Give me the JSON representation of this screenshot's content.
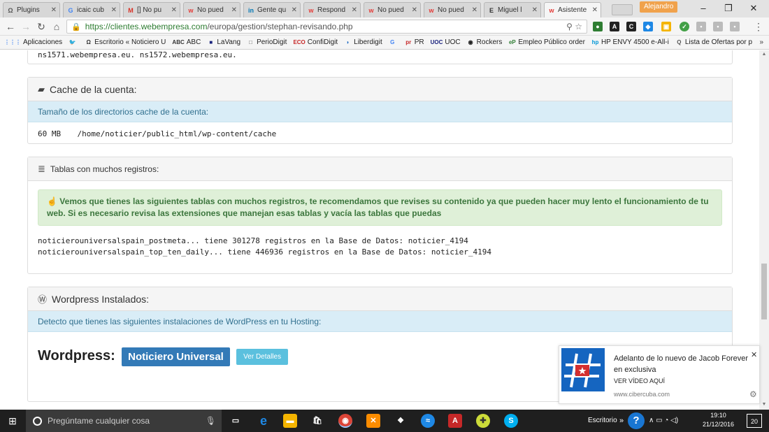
{
  "browser": {
    "tabs": [
      {
        "label": "Plugins",
        "favicon": "Ω",
        "color": "#555"
      },
      {
        "label": "icaic cub",
        "favicon": "G",
        "color": "#4285f4"
      },
      {
        "label": "[] No pu",
        "favicon": "M",
        "color": "#d93025"
      },
      {
        "label": "No pued",
        "favicon": "w",
        "color": "#e53935"
      },
      {
        "label": "Gente qu",
        "favicon": "in",
        "color": "#0077b5"
      },
      {
        "label": "Respond",
        "favicon": "w",
        "color": "#e53935"
      },
      {
        "label": "No pued",
        "favicon": "w",
        "color": "#e53935"
      },
      {
        "label": "No pued",
        "favicon": "w",
        "color": "#e53935"
      },
      {
        "label": "Miguel l",
        "favicon": "E",
        "color": "#333"
      },
      {
        "label": "Asistente",
        "favicon": "w",
        "color": "#e53935",
        "active": true
      }
    ],
    "profile_name": "Alejandro",
    "url_host": "https://clientes.webempresa.com",
    "url_path": "/europa/gestion/stephan-revisando.php",
    "bookmarks": [
      {
        "label": "Aplicaciones",
        "icon": "⋮⋮⋮",
        "color": "#4285f4"
      },
      {
        "label": "",
        "icon": "🐦",
        "color": "#1da1f2"
      },
      {
        "label": "Escritorio « Noticiero U",
        "icon": "Ω",
        "color": "#333"
      },
      {
        "label": "ABC",
        "icon": "ABC",
        "color": "#333"
      },
      {
        "label": "LaVang",
        "icon": "■",
        "color": "#1a237e"
      },
      {
        "label": "PerioDigit",
        "icon": "□",
        "color": "#555"
      },
      {
        "label": "ConfiDigit",
        "icon": "ECO",
        "color": "#c62828"
      },
      {
        "label": "Liberdigit",
        "icon": "◗",
        "color": "#1565c0"
      },
      {
        "label": "",
        "icon": "G",
        "color": "#4285f4"
      },
      {
        "label": "PR",
        "icon": "pr",
        "color": "#c62828"
      },
      {
        "label": "UOC",
        "icon": "UOC",
        "color": "#1a237e"
      },
      {
        "label": "Rockers",
        "icon": "◉",
        "color": "#222"
      },
      {
        "label": "Empleo Público order",
        "icon": "eP",
        "color": "#2e7d32"
      },
      {
        "label": "HP ENVY 4500 e-All-i",
        "icon": "hp",
        "color": "#0096d6"
      },
      {
        "label": "Lista de Ofertas por p",
        "icon": "Q",
        "color": "#555"
      }
    ]
  },
  "page": {
    "nameservers_line": "ns1571.webempresa.eu. ns1572.webempresa.eu.",
    "cache_title": "Cache de la cuenta:",
    "cache_subtitle": "Tamaño de los directorios cache de la cuenta:",
    "cache_size": "60 MB",
    "cache_path": "/home/noticier/public_html/wp-content/cache",
    "tables_title": "Tablas con muchos registros:",
    "tables_alert": "Vemos que tienes las siguientes tablas con muchos registros, te recomendamos que revises su contenido ya que pueden hacer muy lento el funcionamiento de tu web. Si es necesario revisa las extensiones que manejan esas tablas y vacía las tablas que puedas",
    "tables_rows": [
      "noticierouniversalspain_postmeta... tiene 301278 registros en la Base de Datos: noticier_4194",
      "noticierouniversalspain_top_ten_daily... tiene 446936 registros en la Base de Datos: noticier_4194"
    ],
    "wp_title": "Wordpress Instalados:",
    "wp_subtitle": "Detecto que tienes las siguientes instalaciones de WordPress en tu Hosting:",
    "wp_label": "Wordpress:",
    "wp_site": "Noticiero Universal",
    "wp_details": "Ver Detalles"
  },
  "notification": {
    "title": "Adelanto de lo nuevo de Jacob Forever en exclusiva",
    "link": "VER VÍDEO AQUÍ",
    "site": "www.cibercuba.com"
  },
  "taskbar": {
    "search_placeholder": "Pregúntame cualquier cosa",
    "desktop_label": "Escritorio",
    "time": "19:10",
    "date": "21/12/2016",
    "notif_count": "20"
  }
}
